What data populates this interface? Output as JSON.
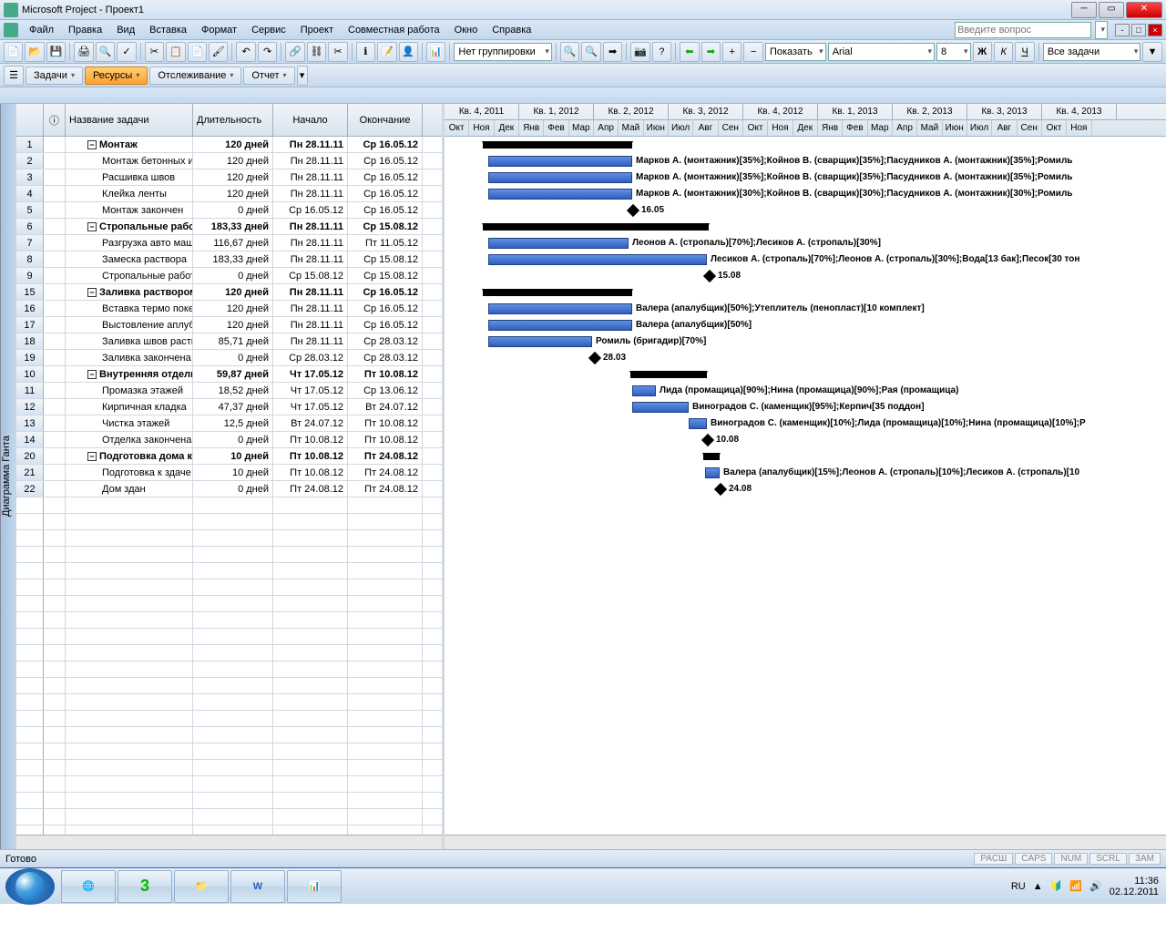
{
  "window": {
    "title": "Microsoft Project - Проект1"
  },
  "menu": {
    "file": "Файл",
    "edit": "Правка",
    "view": "Вид",
    "insert": "Вставка",
    "format": "Формат",
    "service": "Сервис",
    "project": "Проект",
    "collab": "Совместная работа",
    "window": "Окно",
    "help": "Справка",
    "question_ph": "Введите вопрос"
  },
  "toolbar": {
    "grouping": "Нет группировки",
    "show": "Показать",
    "font": "Arial",
    "size": "8",
    "filter": "Все задачи"
  },
  "guides": {
    "tasks": "Задачи",
    "resources": "Ресурсы",
    "tracking": "Отслеживание",
    "report": "Отчет"
  },
  "view_tab": "Диаграмма Ганта",
  "cols": {
    "name": "Название задачи",
    "dur": "Длительность",
    "start": "Начало",
    "end": "Окончание"
  },
  "timeline": {
    "quarters": [
      "Кв. 4, 2011",
      "Кв. 1, 2012",
      "Кв. 2, 2012",
      "Кв. 3, 2012",
      "Кв. 4, 2012",
      "Кв. 1, 2013",
      "Кв. 2, 2013",
      "Кв. 3, 2013",
      "Кв. 4, 2013"
    ],
    "months": [
      "Окт",
      "Ноя",
      "Дек",
      "Янв",
      "Фев",
      "Мар",
      "Апр",
      "Май",
      "Июн",
      "Июл",
      "Авг",
      "Сен",
      "Окт",
      "Ноя",
      "Дек",
      "Янв",
      "Фев",
      "Мар",
      "Апр",
      "Май",
      "Июн",
      "Июл",
      "Авг",
      "Сен",
      "Окт",
      "Ноя"
    ]
  },
  "tasks": [
    {
      "n": "1",
      "name": "Монтаж",
      "dur": "120 дней",
      "start": "Пн 28.11.11",
      "end": "Ср 16.05.12",
      "sum": true,
      "lvl": 1,
      "bx": 42,
      "bw": 164
    },
    {
      "n": "2",
      "name": "Монтаж бетонных изд",
      "dur": "120 дней",
      "start": "Пн 28.11.11",
      "end": "Ср 16.05.12",
      "lvl": 2,
      "bx": 48,
      "bw": 158,
      "res": "Марков А. (монтажник)[35%];Койнов В. (сварщик)[35%];Пасудников А. (монтажник)[35%];Ромиль"
    },
    {
      "n": "3",
      "name": "Расшивка швов",
      "dur": "120 дней",
      "start": "Пн 28.11.11",
      "end": "Ср 16.05.12",
      "lvl": 2,
      "bx": 48,
      "bw": 158,
      "res": "Марков А. (монтажник)[35%];Койнов В. (сварщик)[35%];Пасудников А. (монтажник)[35%];Ромиль"
    },
    {
      "n": "4",
      "name": "Клейка ленты",
      "dur": "120 дней",
      "start": "Пн 28.11.11",
      "end": "Ср 16.05.12",
      "lvl": 2,
      "bx": 48,
      "bw": 158,
      "res": "Марков А. (монтажник)[30%];Койнов В. (сварщик)[30%];Пасудников А. (монтажник)[30%];Ромиль"
    },
    {
      "n": "5",
      "name": "Монтаж закончен",
      "dur": "0 дней",
      "start": "Ср 16.05.12",
      "end": "Ср 16.05.12",
      "lvl": 2,
      "ms": true,
      "mx": 202,
      "ml": "16.05"
    },
    {
      "n": "6",
      "name": "Стропальные работы",
      "dur": "183,33 дней",
      "start": "Пн 28.11.11",
      "end": "Ср 15.08.12",
      "sum": true,
      "lvl": 1,
      "bx": 42,
      "bw": 248
    },
    {
      "n": "7",
      "name": "Разгрузка авто машин",
      "dur": "116,67 дней",
      "start": "Пн 28.11.11",
      "end": "Пт 11.05.12",
      "lvl": 2,
      "bx": 48,
      "bw": 154,
      "res": "Леонов А. (стропаль)[70%];Лесиков А. (стропаль)[30%]"
    },
    {
      "n": "8",
      "name": "Замеска раствора",
      "dur": "183,33 дней",
      "start": "Пн 28.11.11",
      "end": "Ср 15.08.12",
      "lvl": 2,
      "bx": 48,
      "bw": 240,
      "res": "Лесиков А. (стропаль)[70%];Леонов А. (стропаль)[30%];Вода[13 бак];Песок[30 тон"
    },
    {
      "n": "9",
      "name": "Стропальные работы",
      "dur": "0 дней",
      "start": "Ср 15.08.12",
      "end": "Ср 15.08.12",
      "lvl": 2,
      "ms": true,
      "mx": 286,
      "ml": "15.08"
    },
    {
      "n": "15",
      "name": "Заливка раствором",
      "dur": "120 дней",
      "start": "Пн 28.11.11",
      "end": "Ср 16.05.12",
      "sum": true,
      "lvl": 1,
      "bx": 42,
      "bw": 164
    },
    {
      "n": "16",
      "name": "Вставка термо покет",
      "dur": "120 дней",
      "start": "Пн 28.11.11",
      "end": "Ср 16.05.12",
      "lvl": 2,
      "bx": 48,
      "bw": 158,
      "res": "Валера (апалубщик)[50%];Утеплитель (пенопласт)[10 комплект]"
    },
    {
      "n": "17",
      "name": "Выстовление аплубки",
      "dur": "120 дней",
      "start": "Пн 28.11.11",
      "end": "Ср 16.05.12",
      "lvl": 2,
      "bx": 48,
      "bw": 158,
      "res": "Валера (апалубщик)[50%]"
    },
    {
      "n": "18",
      "name": "Заливка швов раство",
      "dur": "85,71 дней",
      "start": "Пн 28.11.11",
      "end": "Ср 28.03.12",
      "lvl": 2,
      "bx": 48,
      "bw": 114,
      "res": "Ромиль (бригадир)[70%]"
    },
    {
      "n": "19",
      "name": "Заливка закончена",
      "dur": "0 дней",
      "start": "Ср 28.03.12",
      "end": "Ср 28.03.12",
      "lvl": 2,
      "ms": true,
      "mx": 160,
      "ml": "28.03"
    },
    {
      "n": "10",
      "name": "Внутренняя отделка",
      "dur": "59,87 дней",
      "start": "Чт 17.05.12",
      "end": "Пт 10.08.12",
      "sum": true,
      "lvl": 1,
      "bx": 204,
      "bw": 84
    },
    {
      "n": "11",
      "name": "Промазка этажей",
      "dur": "18,52 дней",
      "start": "Чт 17.05.12",
      "end": "Ср 13.06.12",
      "lvl": 2,
      "bx": 206,
      "bw": 26,
      "res": "Лида (промащица)[90%];Нина (промащица)[90%];Рая (промащица)"
    },
    {
      "n": "12",
      "name": "Кирпичная кладка",
      "dur": "47,37 дней",
      "start": "Чт 17.05.12",
      "end": "Вт 24.07.12",
      "lvl": 2,
      "bx": 206,
      "bw": 62,
      "res": "Виноградов С. (каменщик)[95%];Керпич[35 поддон]"
    },
    {
      "n": "13",
      "name": "Чистка этажей",
      "dur": "12,5 дней",
      "start": "Вт 24.07.12",
      "end": "Пт 10.08.12",
      "lvl": 2,
      "bx": 268,
      "bw": 20,
      "res": "Виноградов С. (каменщик)[10%];Лида (промащица)[10%];Нина (промащица)[10%];Р"
    },
    {
      "n": "14",
      "name": "Отделка закончена",
      "dur": "0 дней",
      "start": "Пт 10.08.12",
      "end": "Пт 10.08.12",
      "lvl": 2,
      "ms": true,
      "mx": 284,
      "ml": "10.08"
    },
    {
      "n": "20",
      "name": "Подготовка дома к сда",
      "dur": "10 дней",
      "start": "Пт 10.08.12",
      "end": "Пт 24.08.12",
      "sum": true,
      "lvl": 1,
      "bx": 284,
      "bw": 18
    },
    {
      "n": "21",
      "name": "Подготовка к здаче",
      "dur": "10 дней",
      "start": "Пт 10.08.12",
      "end": "Пт 24.08.12",
      "lvl": 2,
      "bx": 286,
      "bw": 16,
      "res": "Валера (апалубщик)[15%];Леонов А. (стропаль)[10%];Лесиков А. (стропаль)[10"
    },
    {
      "n": "22",
      "name": "Дом здан",
      "dur": "0 дней",
      "start": "Пт 24.08.12",
      "end": "Пт 24.08.12",
      "lvl": 2,
      "ms": true,
      "mx": 298,
      "ml": "24.08"
    }
  ],
  "status": {
    "ready": "Готово",
    "ext": "РАСШ",
    "caps": "CAPS",
    "num": "NUM",
    "scrl": "SCRL",
    "over": "ЗАМ"
  },
  "tray": {
    "lang": "RU",
    "time": "11:36",
    "date": "02.12.2011"
  }
}
